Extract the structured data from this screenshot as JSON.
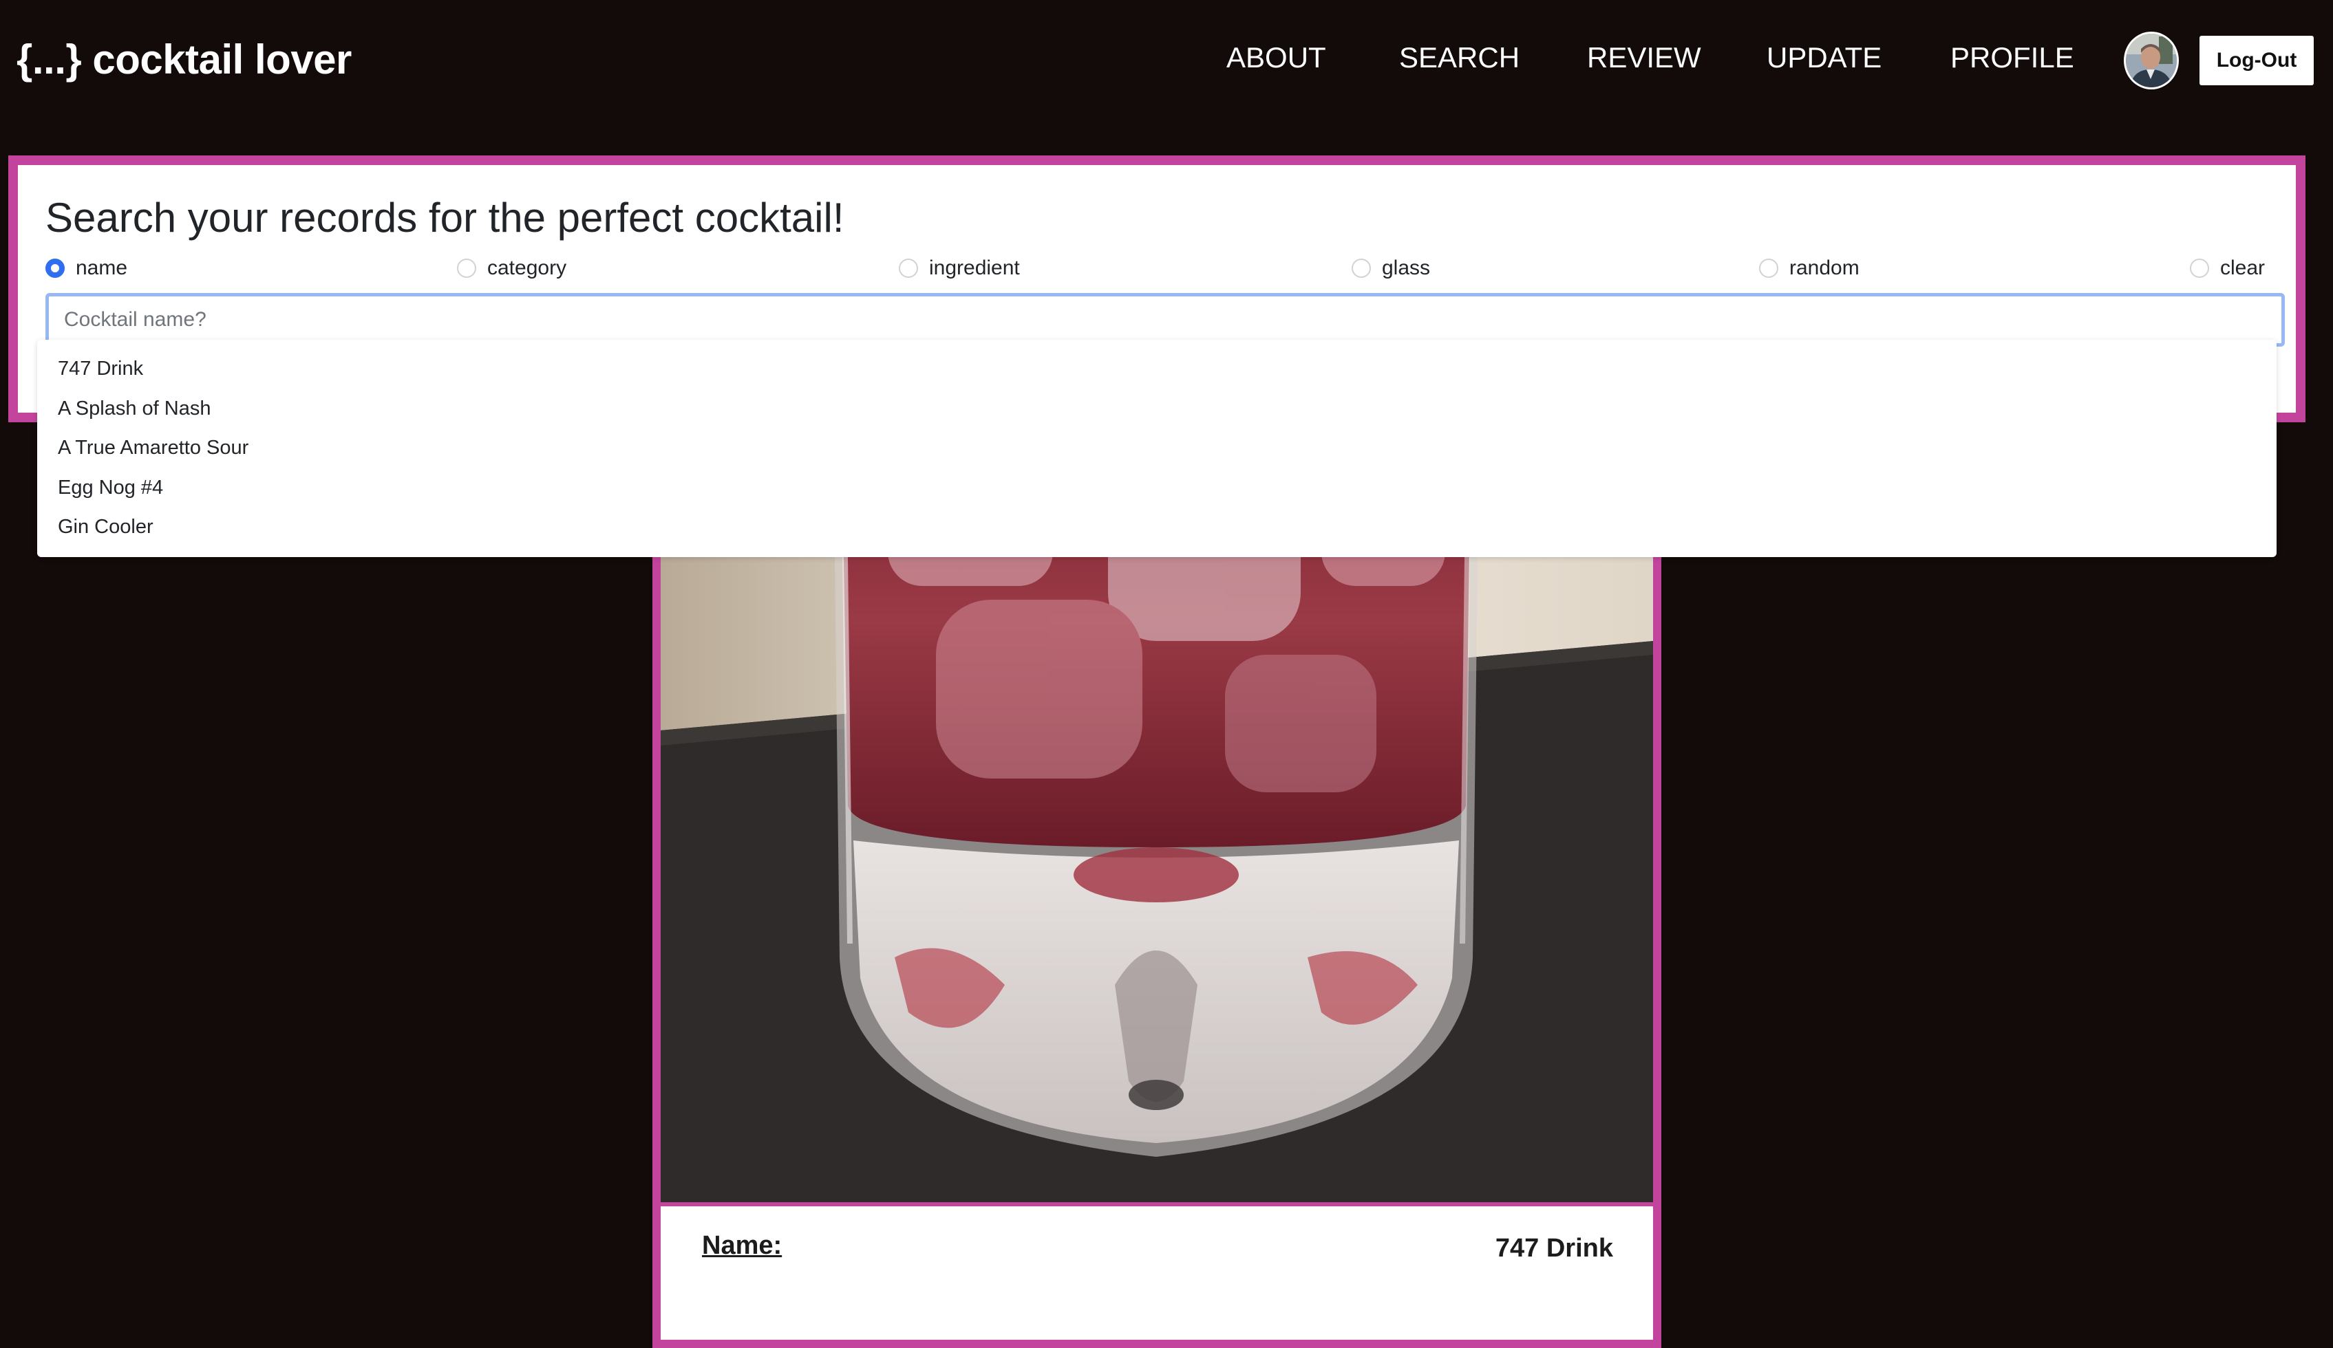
{
  "navbar": {
    "brand": "{...} cocktail lover",
    "links": [
      "ABOUT",
      "SEARCH",
      "REVIEW",
      "UPDATE",
      "PROFILE"
    ],
    "logout_label": "Log-Out"
  },
  "search": {
    "title": "Search your records for the perfect cocktail!",
    "options": [
      {
        "label": "name",
        "checked": true
      },
      {
        "label": "category",
        "checked": false
      },
      {
        "label": "ingredient",
        "checked": false
      },
      {
        "label": "glass",
        "checked": false
      },
      {
        "label": "random",
        "checked": false
      },
      {
        "label": "clear",
        "checked": false
      }
    ],
    "input_value": "",
    "placeholder": "Cocktail name?",
    "suggestions": [
      "747 Drink",
      "A Splash of Nash",
      "A True Amaretto Sour",
      "Egg Nog #4",
      "Gin Cooler"
    ]
  },
  "card": {
    "name_label": "Name:",
    "name_value": "747 Drink"
  },
  "colors": {
    "background": "#130a0a",
    "accent": "#c2449c",
    "radio_checked": "#2f6fef",
    "input_focus": "#97b8f4"
  }
}
